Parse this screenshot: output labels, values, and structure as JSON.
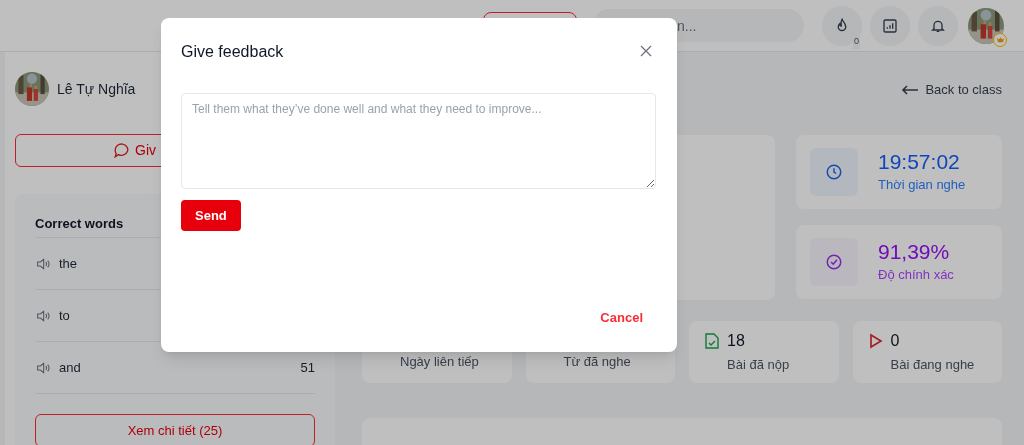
{
  "header": {
    "search": {
      "placeholder": "n..."
    },
    "streak_count": "0"
  },
  "sidebar": {
    "student_name": "Lê Tự Nghĩa",
    "feedback_button": "Giv",
    "correct_words": {
      "title": "Correct words",
      "rows": [
        {
          "word": "the"
        },
        {
          "word": "to"
        },
        {
          "word": "and",
          "count": "51"
        }
      ],
      "more_button": "Xem chi tiết (25)"
    }
  },
  "main": {
    "back_link": "Back to class",
    "stats": [
      {
        "kind": "time",
        "value": "19:57:02",
        "label": "Thời gian nghe"
      },
      {
        "kind": "accuracy",
        "value": "91,39%",
        "label": "Độ chính xác"
      }
    ],
    "summary": [
      {
        "label": "Ngày liên tiếp"
      },
      {
        "label": "Từ đã nghe"
      },
      {
        "kind": "submitted",
        "value": "18",
        "label": "Bài đã nộp"
      },
      {
        "kind": "playing",
        "value": "0",
        "label": "Bài đang nghe"
      }
    ]
  },
  "modal": {
    "title": "Give feedback",
    "placeholder": "Tell them what they’ve done well and what they need to improve...",
    "send_button": "Send",
    "cancel_button": "Cancel"
  }
}
